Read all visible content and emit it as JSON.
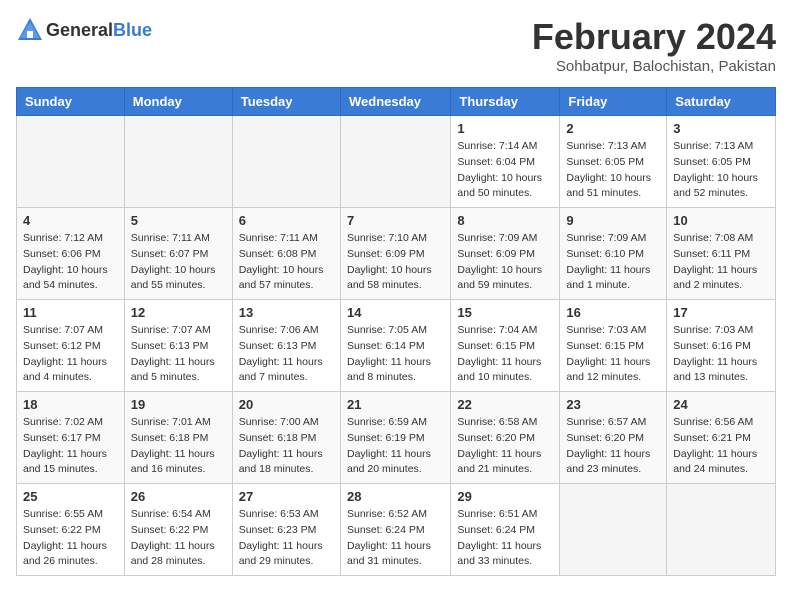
{
  "header": {
    "logo": {
      "general": "General",
      "blue": "Blue"
    },
    "title": "February 2024",
    "subtitle": "Sohbatpur, Balochistan, Pakistan"
  },
  "calendar": {
    "weekdays": [
      "Sunday",
      "Monday",
      "Tuesday",
      "Wednesday",
      "Thursday",
      "Friday",
      "Saturday"
    ],
    "weeks": [
      [
        {
          "day": "",
          "detail": ""
        },
        {
          "day": "",
          "detail": ""
        },
        {
          "day": "",
          "detail": ""
        },
        {
          "day": "",
          "detail": ""
        },
        {
          "day": "1",
          "detail": "Sunrise: 7:14 AM\nSunset: 6:04 PM\nDaylight: 10 hours\nand 50 minutes."
        },
        {
          "day": "2",
          "detail": "Sunrise: 7:13 AM\nSunset: 6:05 PM\nDaylight: 10 hours\nand 51 minutes."
        },
        {
          "day": "3",
          "detail": "Sunrise: 7:13 AM\nSunset: 6:05 PM\nDaylight: 10 hours\nand 52 minutes."
        }
      ],
      [
        {
          "day": "4",
          "detail": "Sunrise: 7:12 AM\nSunset: 6:06 PM\nDaylight: 10 hours\nand 54 minutes."
        },
        {
          "day": "5",
          "detail": "Sunrise: 7:11 AM\nSunset: 6:07 PM\nDaylight: 10 hours\nand 55 minutes."
        },
        {
          "day": "6",
          "detail": "Sunrise: 7:11 AM\nSunset: 6:08 PM\nDaylight: 10 hours\nand 57 minutes."
        },
        {
          "day": "7",
          "detail": "Sunrise: 7:10 AM\nSunset: 6:09 PM\nDaylight: 10 hours\nand 58 minutes."
        },
        {
          "day": "8",
          "detail": "Sunrise: 7:09 AM\nSunset: 6:09 PM\nDaylight: 10 hours\nand 59 minutes."
        },
        {
          "day": "9",
          "detail": "Sunrise: 7:09 AM\nSunset: 6:10 PM\nDaylight: 11 hours\nand 1 minute."
        },
        {
          "day": "10",
          "detail": "Sunrise: 7:08 AM\nSunset: 6:11 PM\nDaylight: 11 hours\nand 2 minutes."
        }
      ],
      [
        {
          "day": "11",
          "detail": "Sunrise: 7:07 AM\nSunset: 6:12 PM\nDaylight: 11 hours\nand 4 minutes."
        },
        {
          "day": "12",
          "detail": "Sunrise: 7:07 AM\nSunset: 6:13 PM\nDaylight: 11 hours\nand 5 minutes."
        },
        {
          "day": "13",
          "detail": "Sunrise: 7:06 AM\nSunset: 6:13 PM\nDaylight: 11 hours\nand 7 minutes."
        },
        {
          "day": "14",
          "detail": "Sunrise: 7:05 AM\nSunset: 6:14 PM\nDaylight: 11 hours\nand 8 minutes."
        },
        {
          "day": "15",
          "detail": "Sunrise: 7:04 AM\nSunset: 6:15 PM\nDaylight: 11 hours\nand 10 minutes."
        },
        {
          "day": "16",
          "detail": "Sunrise: 7:03 AM\nSunset: 6:15 PM\nDaylight: 11 hours\nand 12 minutes."
        },
        {
          "day": "17",
          "detail": "Sunrise: 7:03 AM\nSunset: 6:16 PM\nDaylight: 11 hours\nand 13 minutes."
        }
      ],
      [
        {
          "day": "18",
          "detail": "Sunrise: 7:02 AM\nSunset: 6:17 PM\nDaylight: 11 hours\nand 15 minutes."
        },
        {
          "day": "19",
          "detail": "Sunrise: 7:01 AM\nSunset: 6:18 PM\nDaylight: 11 hours\nand 16 minutes."
        },
        {
          "day": "20",
          "detail": "Sunrise: 7:00 AM\nSunset: 6:18 PM\nDaylight: 11 hours\nand 18 minutes."
        },
        {
          "day": "21",
          "detail": "Sunrise: 6:59 AM\nSunset: 6:19 PM\nDaylight: 11 hours\nand 20 minutes."
        },
        {
          "day": "22",
          "detail": "Sunrise: 6:58 AM\nSunset: 6:20 PM\nDaylight: 11 hours\nand 21 minutes."
        },
        {
          "day": "23",
          "detail": "Sunrise: 6:57 AM\nSunset: 6:20 PM\nDaylight: 11 hours\nand 23 minutes."
        },
        {
          "day": "24",
          "detail": "Sunrise: 6:56 AM\nSunset: 6:21 PM\nDaylight: 11 hours\nand 24 minutes."
        }
      ],
      [
        {
          "day": "25",
          "detail": "Sunrise: 6:55 AM\nSunset: 6:22 PM\nDaylight: 11 hours\nand 26 minutes."
        },
        {
          "day": "26",
          "detail": "Sunrise: 6:54 AM\nSunset: 6:22 PM\nDaylight: 11 hours\nand 28 minutes."
        },
        {
          "day": "27",
          "detail": "Sunrise: 6:53 AM\nSunset: 6:23 PM\nDaylight: 11 hours\nand 29 minutes."
        },
        {
          "day": "28",
          "detail": "Sunrise: 6:52 AM\nSunset: 6:24 PM\nDaylight: 11 hours\nand 31 minutes."
        },
        {
          "day": "29",
          "detail": "Sunrise: 6:51 AM\nSunset: 6:24 PM\nDaylight: 11 hours\nand 33 minutes."
        },
        {
          "day": "",
          "detail": ""
        },
        {
          "day": "",
          "detail": ""
        }
      ]
    ]
  }
}
